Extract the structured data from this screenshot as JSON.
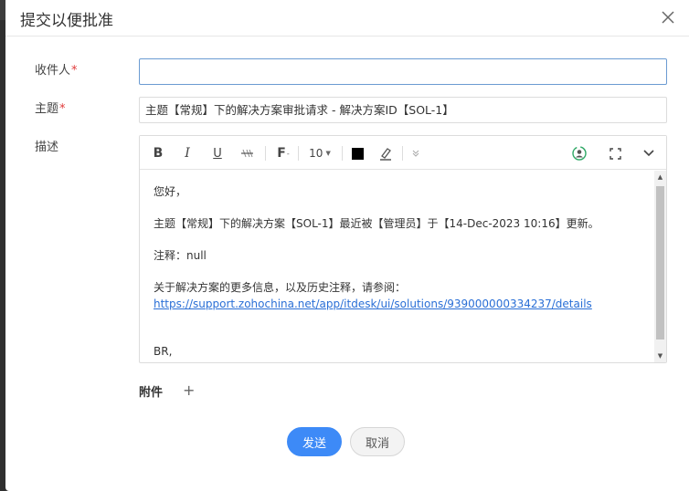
{
  "dialog": {
    "title": "提交以便批准"
  },
  "form": {
    "recipient_label": "收件人",
    "required_mark": "*",
    "recipient_value": "",
    "subject_label": "主题",
    "subject_value": "主题【常规】下的解决方案审批请求 - 解决方案ID【SOL-1】",
    "description_label": "描述"
  },
  "toolbar": {
    "bold": "B",
    "italic": "I",
    "underline": "U",
    "font_button": "F",
    "font_size": "10",
    "icons": [
      "bold-icon",
      "italic-icon",
      "underline-icon",
      "strikethrough-icon",
      "font-family-icon",
      "font-size-dropdown",
      "text-color-icon",
      "highlight-icon",
      "more-icon",
      "sync-icon",
      "fullscreen-icon",
      "collapse-icon"
    ],
    "text_color": "#000000"
  },
  "message": {
    "greeting": "您好，",
    "body": "主题【常规】下的解决方案【SOL-1】最近被【管理员】于【14-Dec-2023 10:16】更新。",
    "comment": "注释：null",
    "more_info": "关于解决方案的更多信息，以及历史注释，请参阅：",
    "link": "https://support.zohochina.net/app/itdesk/ui/solutions/939000000334237/details",
    "signoff": "BR,"
  },
  "attachments": {
    "label": "附件",
    "add": "+"
  },
  "buttons": {
    "send": "发送",
    "cancel": "取消"
  },
  "colors": {
    "primary": "#3d8af7",
    "required": "#e03a3a",
    "link": "#2a6fd6"
  }
}
